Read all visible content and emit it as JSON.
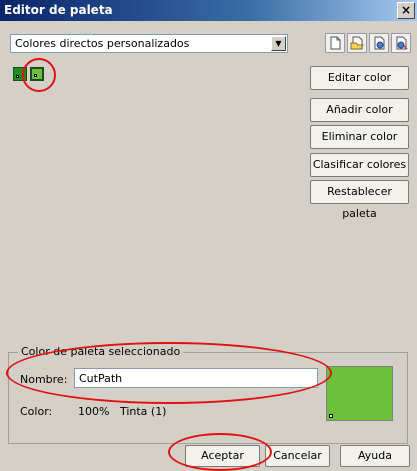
{
  "window": {
    "title": "Editor de paleta",
    "close_glyph": "×"
  },
  "palette_select": {
    "value": "Colores directos personalizados",
    "arrow_glyph": "▼"
  },
  "toolbar": {
    "icons": [
      "new-palette-icon",
      "open-palette-icon",
      "save-palette-icon",
      "save-as-palette-icon"
    ]
  },
  "swatches": [
    {
      "color": "#1f8c1f",
      "selected": false
    },
    {
      "color": "#6cc03c",
      "selected": true
    }
  ],
  "side_buttons": {
    "edit": "Editar color",
    "add": "Añadir color",
    "delete": "Eliminar color",
    "sort": "Clasificar colores ▾",
    "reset": "Restablecer paleta"
  },
  "selected_color": {
    "group_title": "Color de paleta seleccionado",
    "name_label": "Nombre:",
    "name_value": "CutPath",
    "color_label": "Color:",
    "color_value": "100%   Tinta (1)",
    "preview_color": "#6cc03c"
  },
  "footer": {
    "accept": "Aceptar",
    "cancel": "Cancelar",
    "help": "Ayuda"
  },
  "annotation_color": "#e11111"
}
